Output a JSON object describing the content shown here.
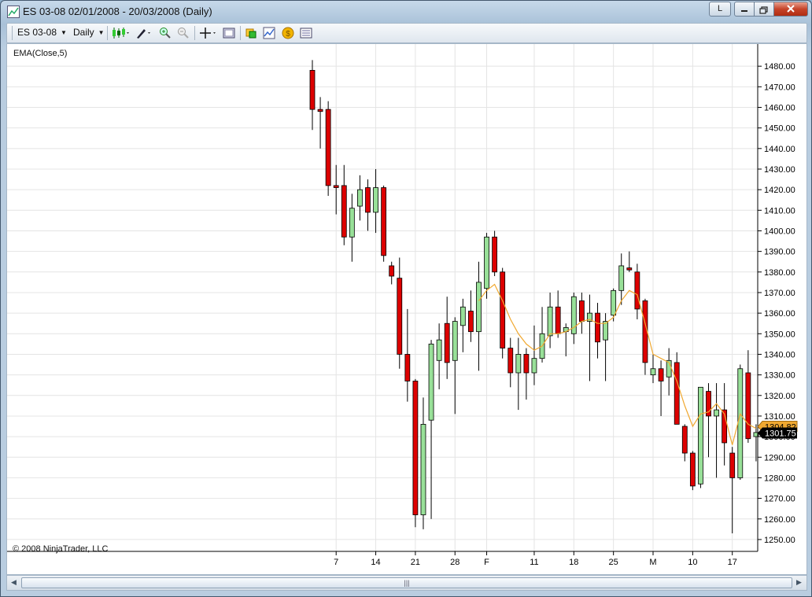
{
  "window": {
    "title": "ES 03-08  02/01/2008 - 20/03/2008 (Daily)",
    "button_l": "L"
  },
  "toolbar": {
    "instrument": "ES 03-08",
    "period": "Daily"
  },
  "chart_data": {
    "type": "candlestick",
    "indicator_label": "EMA(Close,5)",
    "copyright": "© 2008 NinjaTrader, LLC",
    "ylim": [
      1245,
      1490
    ],
    "y_ticks": [
      1250,
      1260,
      1270,
      1280,
      1290,
      1300,
      1310,
      1320,
      1330,
      1340,
      1350,
      1360,
      1370,
      1380,
      1390,
      1400,
      1410,
      1420,
      1430,
      1440,
      1450,
      1460,
      1470,
      1480
    ],
    "y_tick_labels": [
      "1250.00",
      "1260.00",
      "1270.00",
      "1280.00",
      "1290.00",
      "1300.00",
      "1310.00",
      "1320.00",
      "1330.00",
      "1340.00",
      "1350.00",
      "1360.00",
      "1370.00",
      "1380.00",
      "1390.00",
      "1400.00",
      "1410.00",
      "1420.00",
      "1430.00",
      "1440.00",
      "1450.00",
      "1460.00",
      "1470.00",
      "1480.00"
    ],
    "x_ticks": [
      {
        "label": "7",
        "index": 3
      },
      {
        "label": "14",
        "index": 8
      },
      {
        "label": "21",
        "index": 13
      },
      {
        "label": "28",
        "index": 18
      },
      {
        "label": "F",
        "index": 22
      },
      {
        "label": "11",
        "index": 28
      },
      {
        "label": "18",
        "index": 33
      },
      {
        "label": "25",
        "index": 38
      },
      {
        "label": "M",
        "index": 43
      },
      {
        "label": "10",
        "index": 48
      },
      {
        "label": "17",
        "index": 53
      }
    ],
    "up_color": "#98e098",
    "down_color": "#dd0000",
    "ema_color": "#f0a830",
    "candles": [
      {
        "o": 1478,
        "h": 1483,
        "l": 1449,
        "c": 1459
      },
      {
        "o": 1459,
        "h": 1465,
        "l": 1440,
        "c": 1458
      },
      {
        "o": 1459,
        "h": 1463,
        "l": 1417,
        "c": 1422
      },
      {
        "o": 1422,
        "h": 1432,
        "l": 1408,
        "c": 1421
      },
      {
        "o": 1422,
        "h": 1432,
        "l": 1393,
        "c": 1397
      },
      {
        "o": 1397,
        "h": 1418,
        "l": 1385,
        "c": 1411
      },
      {
        "o": 1412,
        "h": 1427,
        "l": 1405,
        "c": 1420
      },
      {
        "o": 1421,
        "h": 1425,
        "l": 1400,
        "c": 1409
      },
      {
        "o": 1409,
        "h": 1430,
        "l": 1399,
        "c": 1421
      },
      {
        "o": 1421,
        "h": 1422,
        "l": 1385,
        "c": 1388
      },
      {
        "o": 1383,
        "h": 1385,
        "l": 1374,
        "c": 1378
      },
      {
        "o": 1377,
        "h": 1387,
        "l": 1333,
        "c": 1340
      },
      {
        "o": 1340,
        "h": 1362,
        "l": 1317,
        "c": 1327
      },
      {
        "o": 1327,
        "h": 1328,
        "l": 1256,
        "c": 1262
      },
      {
        "o": 1262,
        "h": 1319,
        "l": 1255,
        "c": 1306
      },
      {
        "o": 1308,
        "h": 1347,
        "l": 1260,
        "c": 1345
      },
      {
        "o": 1337,
        "h": 1355,
        "l": 1323,
        "c": 1347
      },
      {
        "o": 1355,
        "h": 1368,
        "l": 1328,
        "c": 1336
      },
      {
        "o": 1337,
        "h": 1358,
        "l": 1311,
        "c": 1356
      },
      {
        "o": 1354,
        "h": 1367,
        "l": 1341,
        "c": 1363
      },
      {
        "o": 1361,
        "h": 1371,
        "l": 1346,
        "c": 1351
      },
      {
        "o": 1351,
        "h": 1385,
        "l": 1332,
        "c": 1375
      },
      {
        "o": 1372,
        "h": 1399,
        "l": 1367,
        "c": 1397
      },
      {
        "o": 1397,
        "h": 1400,
        "l": 1378,
        "c": 1380
      },
      {
        "o": 1380,
        "h": 1382,
        "l": 1338,
        "c": 1343
      },
      {
        "o": 1343,
        "h": 1348,
        "l": 1324,
        "c": 1331
      },
      {
        "o": 1331,
        "h": 1348,
        "l": 1313,
        "c": 1340
      },
      {
        "o": 1340,
        "h": 1343,
        "l": 1318,
        "c": 1331
      },
      {
        "o": 1331,
        "h": 1354,
        "l": 1325,
        "c": 1338
      },
      {
        "o": 1338,
        "h": 1363,
        "l": 1336,
        "c": 1350
      },
      {
        "o": 1349,
        "h": 1370,
        "l": 1343,
        "c": 1363
      },
      {
        "o": 1363,
        "h": 1371,
        "l": 1348,
        "c": 1350
      },
      {
        "o": 1351,
        "h": 1355,
        "l": 1339,
        "c": 1353
      },
      {
        "o": 1350,
        "h": 1370,
        "l": 1345,
        "c": 1368
      },
      {
        "o": 1366,
        "h": 1370,
        "l": 1350,
        "c": 1356
      },
      {
        "o": 1356,
        "h": 1369,
        "l": 1327,
        "c": 1360
      },
      {
        "o": 1360,
        "h": 1365,
        "l": 1338,
        "c": 1346
      },
      {
        "o": 1347,
        "h": 1360,
        "l": 1327,
        "c": 1356
      },
      {
        "o": 1359,
        "h": 1372,
        "l": 1356,
        "c": 1371
      },
      {
        "o": 1371,
        "h": 1389,
        "l": 1364,
        "c": 1383
      },
      {
        "o": 1382,
        "h": 1390,
        "l": 1380,
        "c": 1381
      },
      {
        "o": 1380,
        "h": 1384,
        "l": 1357,
        "c": 1362
      },
      {
        "o": 1366,
        "h": 1367,
        "l": 1330,
        "c": 1336
      },
      {
        "o": 1330,
        "h": 1340,
        "l": 1326,
        "c": 1333
      },
      {
        "o": 1333,
        "h": 1337,
        "l": 1310,
        "c": 1327
      },
      {
        "o": 1329,
        "h": 1343,
        "l": 1320,
        "c": 1337
      },
      {
        "o": 1336,
        "h": 1341,
        "l": 1307,
        "c": 1306
      },
      {
        "o": 1305,
        "h": 1306,
        "l": 1288,
        "c": 1292
      },
      {
        "o": 1292,
        "h": 1293,
        "l": 1274,
        "c": 1276
      },
      {
        "o": 1277,
        "h": 1324,
        "l": 1275,
        "c": 1324
      },
      {
        "o": 1322,
        "h": 1326,
        "l": 1290,
        "c": 1310
      },
      {
        "o": 1310,
        "h": 1326,
        "l": 1280,
        "c": 1313
      },
      {
        "o": 1313,
        "h": 1326,
        "l": 1286,
        "c": 1297
      },
      {
        "o": 1292,
        "h": 1295,
        "l": 1253,
        "c": 1280
      },
      {
        "o": 1280,
        "h": 1335,
        "l": 1279,
        "c": 1333
      },
      {
        "o": 1331,
        "h": 1342,
        "l": 1297,
        "c": 1299
      },
      {
        "o": 1300,
        "h": 1306,
        "l": 1288,
        "c": 1302
      }
    ],
    "ema": [
      null,
      null,
      null,
      null,
      null,
      null,
      null,
      null,
      null,
      null,
      null,
      null,
      null,
      null,
      null,
      null,
      null,
      null,
      null,
      null,
      null,
      1366,
      1371,
      1374,
      1366,
      1357,
      1350,
      1345,
      1342,
      1344,
      1350,
      1350,
      1351,
      1353,
      1356,
      1357,
      1355,
      1355,
      1358,
      1366,
      1371,
      1369,
      1355,
      1340,
      1338,
      1336,
      1327,
      1315,
      1305,
      1311,
      1312,
      1316,
      1311,
      1296,
      1311,
      1306,
      1304
    ],
    "ema_last_label": "1304.82",
    "last_price_label": "1301.75"
  }
}
